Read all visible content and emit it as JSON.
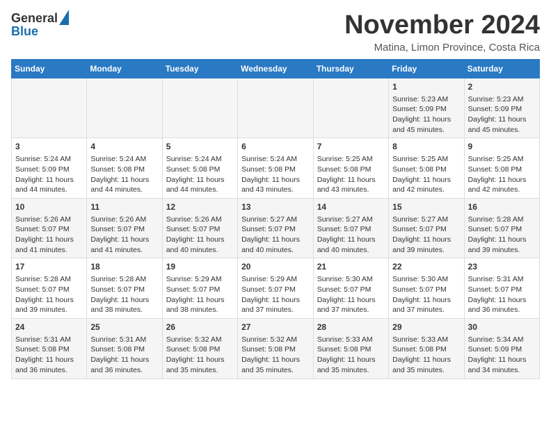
{
  "logo": {
    "line1": "General",
    "line2": "Blue"
  },
  "title": "November 2024",
  "location": "Matina, Limon Province, Costa Rica",
  "days_of_week": [
    "Sunday",
    "Monday",
    "Tuesday",
    "Wednesday",
    "Thursday",
    "Friday",
    "Saturday"
  ],
  "weeks": [
    [
      {
        "day": "",
        "info": ""
      },
      {
        "day": "",
        "info": ""
      },
      {
        "day": "",
        "info": ""
      },
      {
        "day": "",
        "info": ""
      },
      {
        "day": "",
        "info": ""
      },
      {
        "day": "1",
        "info": "Sunrise: 5:23 AM\nSunset: 5:09 PM\nDaylight: 11 hours and 45 minutes."
      },
      {
        "day": "2",
        "info": "Sunrise: 5:23 AM\nSunset: 5:09 PM\nDaylight: 11 hours and 45 minutes."
      }
    ],
    [
      {
        "day": "3",
        "info": "Sunrise: 5:24 AM\nSunset: 5:09 PM\nDaylight: 11 hours and 44 minutes."
      },
      {
        "day": "4",
        "info": "Sunrise: 5:24 AM\nSunset: 5:08 PM\nDaylight: 11 hours and 44 minutes."
      },
      {
        "day": "5",
        "info": "Sunrise: 5:24 AM\nSunset: 5:08 PM\nDaylight: 11 hours and 44 minutes."
      },
      {
        "day": "6",
        "info": "Sunrise: 5:24 AM\nSunset: 5:08 PM\nDaylight: 11 hours and 43 minutes."
      },
      {
        "day": "7",
        "info": "Sunrise: 5:25 AM\nSunset: 5:08 PM\nDaylight: 11 hours and 43 minutes."
      },
      {
        "day": "8",
        "info": "Sunrise: 5:25 AM\nSunset: 5:08 PM\nDaylight: 11 hours and 42 minutes."
      },
      {
        "day": "9",
        "info": "Sunrise: 5:25 AM\nSunset: 5:08 PM\nDaylight: 11 hours and 42 minutes."
      }
    ],
    [
      {
        "day": "10",
        "info": "Sunrise: 5:26 AM\nSunset: 5:07 PM\nDaylight: 11 hours and 41 minutes."
      },
      {
        "day": "11",
        "info": "Sunrise: 5:26 AM\nSunset: 5:07 PM\nDaylight: 11 hours and 41 minutes."
      },
      {
        "day": "12",
        "info": "Sunrise: 5:26 AM\nSunset: 5:07 PM\nDaylight: 11 hours and 40 minutes."
      },
      {
        "day": "13",
        "info": "Sunrise: 5:27 AM\nSunset: 5:07 PM\nDaylight: 11 hours and 40 minutes."
      },
      {
        "day": "14",
        "info": "Sunrise: 5:27 AM\nSunset: 5:07 PM\nDaylight: 11 hours and 40 minutes."
      },
      {
        "day": "15",
        "info": "Sunrise: 5:27 AM\nSunset: 5:07 PM\nDaylight: 11 hours and 39 minutes."
      },
      {
        "day": "16",
        "info": "Sunrise: 5:28 AM\nSunset: 5:07 PM\nDaylight: 11 hours and 39 minutes."
      }
    ],
    [
      {
        "day": "17",
        "info": "Sunrise: 5:28 AM\nSunset: 5:07 PM\nDaylight: 11 hours and 39 minutes."
      },
      {
        "day": "18",
        "info": "Sunrise: 5:28 AM\nSunset: 5:07 PM\nDaylight: 11 hours and 38 minutes."
      },
      {
        "day": "19",
        "info": "Sunrise: 5:29 AM\nSunset: 5:07 PM\nDaylight: 11 hours and 38 minutes."
      },
      {
        "day": "20",
        "info": "Sunrise: 5:29 AM\nSunset: 5:07 PM\nDaylight: 11 hours and 37 minutes."
      },
      {
        "day": "21",
        "info": "Sunrise: 5:30 AM\nSunset: 5:07 PM\nDaylight: 11 hours and 37 minutes."
      },
      {
        "day": "22",
        "info": "Sunrise: 5:30 AM\nSunset: 5:07 PM\nDaylight: 11 hours and 37 minutes."
      },
      {
        "day": "23",
        "info": "Sunrise: 5:31 AM\nSunset: 5:07 PM\nDaylight: 11 hours and 36 minutes."
      }
    ],
    [
      {
        "day": "24",
        "info": "Sunrise: 5:31 AM\nSunset: 5:08 PM\nDaylight: 11 hours and 36 minutes."
      },
      {
        "day": "25",
        "info": "Sunrise: 5:31 AM\nSunset: 5:08 PM\nDaylight: 11 hours and 36 minutes."
      },
      {
        "day": "26",
        "info": "Sunrise: 5:32 AM\nSunset: 5:08 PM\nDaylight: 11 hours and 35 minutes."
      },
      {
        "day": "27",
        "info": "Sunrise: 5:32 AM\nSunset: 5:08 PM\nDaylight: 11 hours and 35 minutes."
      },
      {
        "day": "28",
        "info": "Sunrise: 5:33 AM\nSunset: 5:08 PM\nDaylight: 11 hours and 35 minutes."
      },
      {
        "day": "29",
        "info": "Sunrise: 5:33 AM\nSunset: 5:08 PM\nDaylight: 11 hours and 35 minutes."
      },
      {
        "day": "30",
        "info": "Sunrise: 5:34 AM\nSunset: 5:09 PM\nDaylight: 11 hours and 34 minutes."
      }
    ]
  ]
}
